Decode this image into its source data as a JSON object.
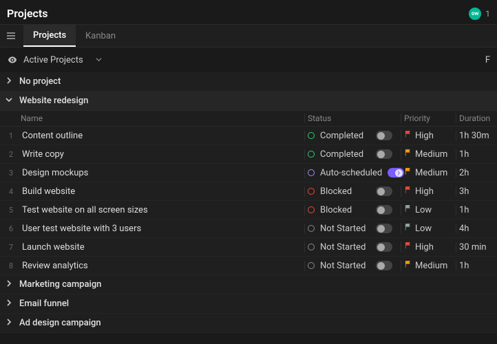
{
  "header": {
    "title": "Projects",
    "avatar_initials": "ow",
    "number_hint": "1"
  },
  "tabs": {
    "projects": "Projects",
    "kanban": "Kanban"
  },
  "view": {
    "name": "Active Projects",
    "right_letter": "F"
  },
  "columns": {
    "name": "Name",
    "status": "Status",
    "priority": "Priority",
    "duration": "Duration"
  },
  "status_colors": {
    "Completed": "#2ecc71",
    "Auto-scheduled": "#a78bfa",
    "Blocked": "#e74c3c",
    "Not Started": "#888888"
  },
  "priority_colors": {
    "High": "#e74c3c",
    "Medium": "#f39c12",
    "Low": "#95a5a6"
  },
  "groups": [
    {
      "name": "No project",
      "expanded": false
    },
    {
      "name": "Website redesign",
      "expanded": true,
      "tasks": [
        {
          "n": "1",
          "name": "Content outline",
          "status": "Completed",
          "toggle": "off",
          "priority": "High",
          "duration": "1h 30m"
        },
        {
          "n": "2",
          "name": "Write copy",
          "status": "Completed",
          "toggle": "off",
          "priority": "Medium",
          "duration": "1h"
        },
        {
          "n": "3",
          "name": "Design mockups",
          "status": "Auto-scheduled",
          "toggle": "on",
          "priority": "Medium",
          "duration": "2h"
        },
        {
          "n": "4",
          "name": "Build website",
          "status": "Blocked",
          "toggle": "off",
          "priority": "High",
          "duration": "3h"
        },
        {
          "n": "5",
          "name": "Test website on all screen sizes",
          "status": "Blocked",
          "toggle": "off",
          "priority": "Low",
          "duration": "1h"
        },
        {
          "n": "6",
          "name": "User test website with 3 users",
          "status": "Not Started",
          "toggle": "off",
          "priority": "Low",
          "duration": "4h"
        },
        {
          "n": "7",
          "name": "Launch website",
          "status": "Not Started",
          "toggle": "off",
          "priority": "High",
          "duration": "30 min"
        },
        {
          "n": "8",
          "name": "Review analytics",
          "status": "Not Started",
          "toggle": "off",
          "priority": "Medium",
          "duration": "1h"
        }
      ]
    },
    {
      "name": "Marketing campaign",
      "expanded": false
    },
    {
      "name": "Email funnel",
      "expanded": false
    },
    {
      "name": "Ad design campaign",
      "expanded": false
    }
  ]
}
